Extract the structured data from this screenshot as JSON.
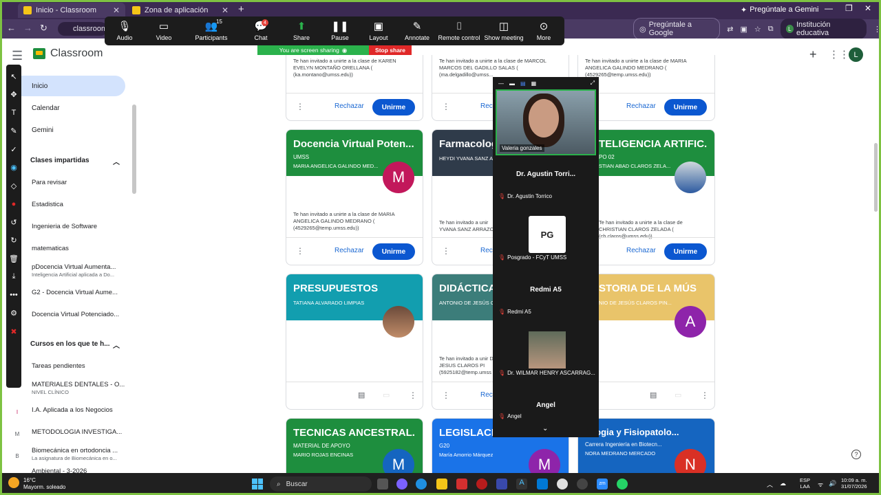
{
  "browser": {
    "tabs": [
      {
        "title": "Inicio - Classroom",
        "active": true
      },
      {
        "title": "Zona de aplicación",
        "active": false
      }
    ],
    "ask_gemini": "Pregúntale a Gemini",
    "url": "classroom.g",
    "ask_google": "Pregúntale a Google",
    "profile_initial": "L",
    "profile_label": "Institución educativa"
  },
  "zoom_toolbar": {
    "items": [
      {
        "label": "Audio",
        "icon": "mic-icon"
      },
      {
        "label": "Video",
        "icon": "video-icon"
      },
      {
        "label": "Participants",
        "icon": "participants-icon",
        "count": "15"
      },
      {
        "label": "Chat",
        "icon": "chat-icon",
        "badge": "4"
      },
      {
        "label": "Share",
        "icon": "share-icon"
      },
      {
        "label": "Pause",
        "icon": "pause-icon"
      },
      {
        "label": "Layout",
        "icon": "layout-icon"
      },
      {
        "label": "Annotate",
        "icon": "pen-icon"
      },
      {
        "label": "Remote control",
        "icon": "mouse-icon"
      },
      {
        "label": "Show meeting",
        "icon": "window-icon"
      },
      {
        "label": "More",
        "icon": "more-icon"
      }
    ],
    "sharing_text": "You are screen sharing",
    "stop_share": "Stop share"
  },
  "classroom": {
    "brand": "Classroom",
    "avatar_initial": "L",
    "nav": [
      {
        "label": "Inicio"
      },
      {
        "label": "Calendar"
      },
      {
        "label": "Gemini"
      }
    ],
    "teaching_header": "Clases impartidas",
    "teaching": [
      {
        "label": "Para revisar",
        "sub": ""
      },
      {
        "label": "Estadistica",
        "sub": ""
      },
      {
        "label": "Ingenieria de Software",
        "sub": ""
      },
      {
        "label": "matematicas",
        "sub": ""
      },
      {
        "label": "pDocencia Virtual Aumenta...",
        "sub": "Inteligencia Artificial aplicada a Do..."
      },
      {
        "label": "G2 - Docencia Virtual Aume...",
        "sub": ""
      },
      {
        "label": "Docencia Virtual Potenciado...",
        "sub": ""
      }
    ],
    "enrolled_header": "Cursos en los que te h...",
    "enrolled": [
      {
        "letter": "",
        "label": "Tareas pendientes",
        "sub": ""
      },
      {
        "letter": "",
        "label": "MATERIALES DENTALES - O...",
        "sub": "NIVEL CLÍNICO"
      },
      {
        "letter": "I",
        "label": "I.A. Aplicada a los Negocios",
        "sub": ""
      },
      {
        "letter": "M",
        "label": "METODOLOGIA INVESTIGA...",
        "sub": ""
      },
      {
        "letter": "B",
        "label": "Biomecánica en ortodoncia ...",
        "sub": "La asignatura de Biomecánica en o..."
      },
      {
        "letter": "",
        "label": "Ambiental - 3-2026",
        "sub": ""
      }
    ],
    "reject_label": "Rechazar",
    "join_label": "Unirme",
    "top_cards": [
      {
        "invite": "Te han invitado a unirte a la clase de KAREN EVELYN MONTAÑO ORELLANA ( (ka.montano@umss.edu))"
      },
      {
        "invite": "Te han invitado a unirte a la clase de MARCOL MARCOS DEL GADILLO SALAS ( (ma.delgadillo@umss..."
      },
      {
        "invite": "Te han invitado a unirte a la clase de MARIA ANGELICA GALINDO MEDRANO ( (4529265@temp.umss.edu))"
      }
    ],
    "row1": [
      {
        "title": "Docencia Virtual Poten...",
        "sub": "UMSS",
        "teacher": "MARIA ANGELICA GALINDO MED...",
        "avatar": "M",
        "color": "#1e8e3e",
        "avatar_color": "#c2185b",
        "invite": "Te han invitado a unirte a la clase de MARIA ANGELICA GALINDO MEDRANO ( (4529265@temp.umss.edu))"
      },
      {
        "title": "Farmacolog",
        "sub": "",
        "teacher": "HEYDI YVANA SANZ A",
        "avatar": "",
        "color": "#2f3b4a",
        "avatar_color": "",
        "invite": "Te han invitado a unir YVANA SANZ ARRAZO"
      },
      {
        "title": "TELIGENCIA ARTIFIC...",
        "sub": "PO 02",
        "teacher": "STIAN ABAD CLAROS ZELA...",
        "avatar": "",
        "color": "#1e8e3e",
        "avatar_color": "",
        "invite": "Te han invitado a unirte a la clase de CHRISTIAN CLAROS ZELADA ( (ch.claros@umss.edu))"
      }
    ],
    "row2": [
      {
        "title": "PRESUPUESTOS",
        "sub": "",
        "teacher": "TATIANA ALVARADO LIMPIAS",
        "avatar": "",
        "color": "#129eaf",
        "avatar_color": "",
        "invite": ""
      },
      {
        "title": "DIDÁCTICA",
        "sub": "",
        "teacher": "ANTONIO DE JESÚS CL",
        "avatar": "",
        "color": "#3c7d7a",
        "avatar_color": "",
        "invite": "Te han invitado a unir DE JESUS CLAROS PI (5925182@temp.umss"
      },
      {
        "title": "STORIA DE LA MÚS",
        "sub": "",
        "teacher": "NIO DE JESÚS CLAROS PIN...",
        "avatar": "A",
        "color": "#e9c46a",
        "avatar_color": "#8e24aa",
        "invite": ""
      }
    ],
    "row3": [
      {
        "title": "TECNICAS ANCESTRAL...",
        "sub": "MATERIAL DE APOYO",
        "teacher": "MARIO ROJAS ENCINAS",
        "avatar": "M",
        "color": "#1e8e3e",
        "avatar_color": "#1565c0"
      },
      {
        "title": "LEGISLACIO",
        "sub": "G20",
        "teacher": "María Amorrio Márquez",
        "avatar": "M",
        "color": "#1a73e8",
        "avatar_color": "#8e24aa"
      },
      {
        "title": "iologia y Fisiopatolo...",
        "sub": "Carrera Ingeniería en Biotecn...",
        "teacher": "NORA MEDRANO MERCADO",
        "avatar": "N",
        "color": "#1565c0",
        "avatar_color": "#d93025"
      }
    ]
  },
  "zoom_panel": {
    "self_label": "Valeria gonzales",
    "participants": [
      {
        "name": "Dr. Agustin Torri...",
        "label": "Dr. Agustin Torrico",
        "pic": ""
      },
      {
        "name": "",
        "label": "Posgrado - FCyT UMSS",
        "pic": "logo"
      },
      {
        "name": "Redmi A5",
        "label": "Redmi A5",
        "pic": ""
      },
      {
        "name": "",
        "label": "Dr. WILMAR HENRY ASCARRAG...",
        "pic": "photo"
      },
      {
        "name": "Angel",
        "label": "Angel",
        "pic": ""
      }
    ]
  },
  "taskbar": {
    "temp": "16°C",
    "weather": "Mayorm. soleado",
    "search": "Buscar",
    "lang1": "ESP",
    "lang2": "LAA",
    "time": "10:09 a. m.",
    "date": "31/07/2026"
  }
}
